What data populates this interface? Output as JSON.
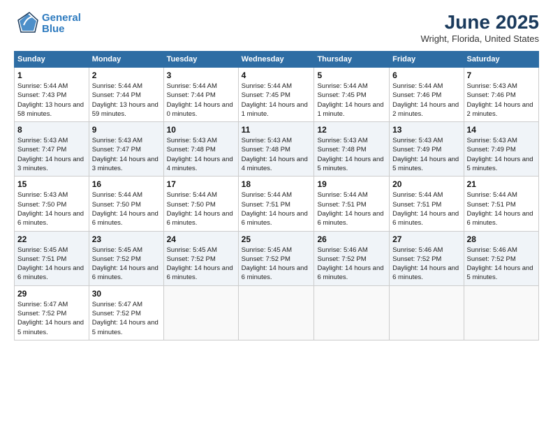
{
  "logo": {
    "line1": "General",
    "line2": "Blue"
  },
  "title": "June 2025",
  "location": "Wright, Florida, United States",
  "days_of_week": [
    "Sunday",
    "Monday",
    "Tuesday",
    "Wednesday",
    "Thursday",
    "Friday",
    "Saturday"
  ],
  "weeks": [
    [
      {
        "day": "1",
        "sunrise": "5:44 AM",
        "sunset": "7:43 PM",
        "daylight": "13 hours and 58 minutes."
      },
      {
        "day": "2",
        "sunrise": "5:44 AM",
        "sunset": "7:44 PM",
        "daylight": "13 hours and 59 minutes."
      },
      {
        "day": "3",
        "sunrise": "5:44 AM",
        "sunset": "7:44 PM",
        "daylight": "14 hours and 0 minutes."
      },
      {
        "day": "4",
        "sunrise": "5:44 AM",
        "sunset": "7:45 PM",
        "daylight": "14 hours and 1 minute."
      },
      {
        "day": "5",
        "sunrise": "5:44 AM",
        "sunset": "7:45 PM",
        "daylight": "14 hours and 1 minute."
      },
      {
        "day": "6",
        "sunrise": "5:44 AM",
        "sunset": "7:46 PM",
        "daylight": "14 hours and 2 minutes."
      },
      {
        "day": "7",
        "sunrise": "5:43 AM",
        "sunset": "7:46 PM",
        "daylight": "14 hours and 2 minutes."
      }
    ],
    [
      {
        "day": "8",
        "sunrise": "5:43 AM",
        "sunset": "7:47 PM",
        "daylight": "14 hours and 3 minutes."
      },
      {
        "day": "9",
        "sunrise": "5:43 AM",
        "sunset": "7:47 PM",
        "daylight": "14 hours and 3 minutes."
      },
      {
        "day": "10",
        "sunrise": "5:43 AM",
        "sunset": "7:48 PM",
        "daylight": "14 hours and 4 minutes."
      },
      {
        "day": "11",
        "sunrise": "5:43 AM",
        "sunset": "7:48 PM",
        "daylight": "14 hours and 4 minutes."
      },
      {
        "day": "12",
        "sunrise": "5:43 AM",
        "sunset": "7:48 PM",
        "daylight": "14 hours and 5 minutes."
      },
      {
        "day": "13",
        "sunrise": "5:43 AM",
        "sunset": "7:49 PM",
        "daylight": "14 hours and 5 minutes."
      },
      {
        "day": "14",
        "sunrise": "5:43 AM",
        "sunset": "7:49 PM",
        "daylight": "14 hours and 5 minutes."
      }
    ],
    [
      {
        "day": "15",
        "sunrise": "5:43 AM",
        "sunset": "7:50 PM",
        "daylight": "14 hours and 6 minutes."
      },
      {
        "day": "16",
        "sunrise": "5:44 AM",
        "sunset": "7:50 PM",
        "daylight": "14 hours and 6 minutes."
      },
      {
        "day": "17",
        "sunrise": "5:44 AM",
        "sunset": "7:50 PM",
        "daylight": "14 hours and 6 minutes."
      },
      {
        "day": "18",
        "sunrise": "5:44 AM",
        "sunset": "7:51 PM",
        "daylight": "14 hours and 6 minutes."
      },
      {
        "day": "19",
        "sunrise": "5:44 AM",
        "sunset": "7:51 PM",
        "daylight": "14 hours and 6 minutes."
      },
      {
        "day": "20",
        "sunrise": "5:44 AM",
        "sunset": "7:51 PM",
        "daylight": "14 hours and 6 minutes."
      },
      {
        "day": "21",
        "sunrise": "5:44 AM",
        "sunset": "7:51 PM",
        "daylight": "14 hours and 6 minutes."
      }
    ],
    [
      {
        "day": "22",
        "sunrise": "5:45 AM",
        "sunset": "7:51 PM",
        "daylight": "14 hours and 6 minutes."
      },
      {
        "day": "23",
        "sunrise": "5:45 AM",
        "sunset": "7:52 PM",
        "daylight": "14 hours and 6 minutes."
      },
      {
        "day": "24",
        "sunrise": "5:45 AM",
        "sunset": "7:52 PM",
        "daylight": "14 hours and 6 minutes."
      },
      {
        "day": "25",
        "sunrise": "5:45 AM",
        "sunset": "7:52 PM",
        "daylight": "14 hours and 6 minutes."
      },
      {
        "day": "26",
        "sunrise": "5:46 AM",
        "sunset": "7:52 PM",
        "daylight": "14 hours and 6 minutes."
      },
      {
        "day": "27",
        "sunrise": "5:46 AM",
        "sunset": "7:52 PM",
        "daylight": "14 hours and 6 minutes."
      },
      {
        "day": "28",
        "sunrise": "5:46 AM",
        "sunset": "7:52 PM",
        "daylight": "14 hours and 5 minutes."
      }
    ],
    [
      {
        "day": "29",
        "sunrise": "5:47 AM",
        "sunset": "7:52 PM",
        "daylight": "14 hours and 5 minutes."
      },
      {
        "day": "30",
        "sunrise": "5:47 AM",
        "sunset": "7:52 PM",
        "daylight": "14 hours and 5 minutes."
      },
      null,
      null,
      null,
      null,
      null
    ]
  ]
}
